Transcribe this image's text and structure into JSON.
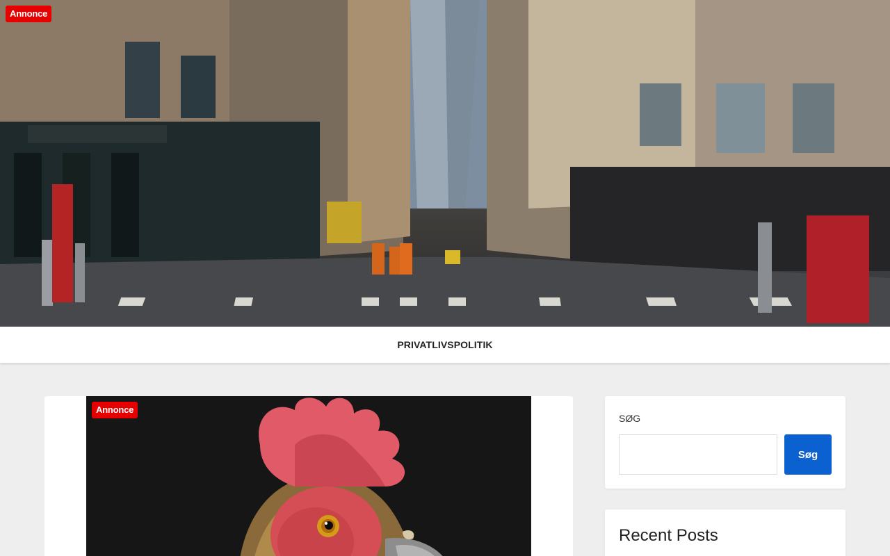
{
  "hero": {
    "badge": "Annonce",
    "image": "city-street-photo"
  },
  "nav": {
    "items": [
      {
        "label": "PRIVATLIVSPOLITIK"
      }
    ]
  },
  "post": {
    "badge": "Annonce",
    "image": "rooster-photo"
  },
  "sidebar": {
    "search": {
      "title": "SØG",
      "input_value": "",
      "button_label": "Søg"
    },
    "recent": {
      "title": "Recent Posts"
    }
  },
  "colors": {
    "badge": "#e60000",
    "button": "#0b61cf",
    "page_bg": "#eeeeee"
  }
}
